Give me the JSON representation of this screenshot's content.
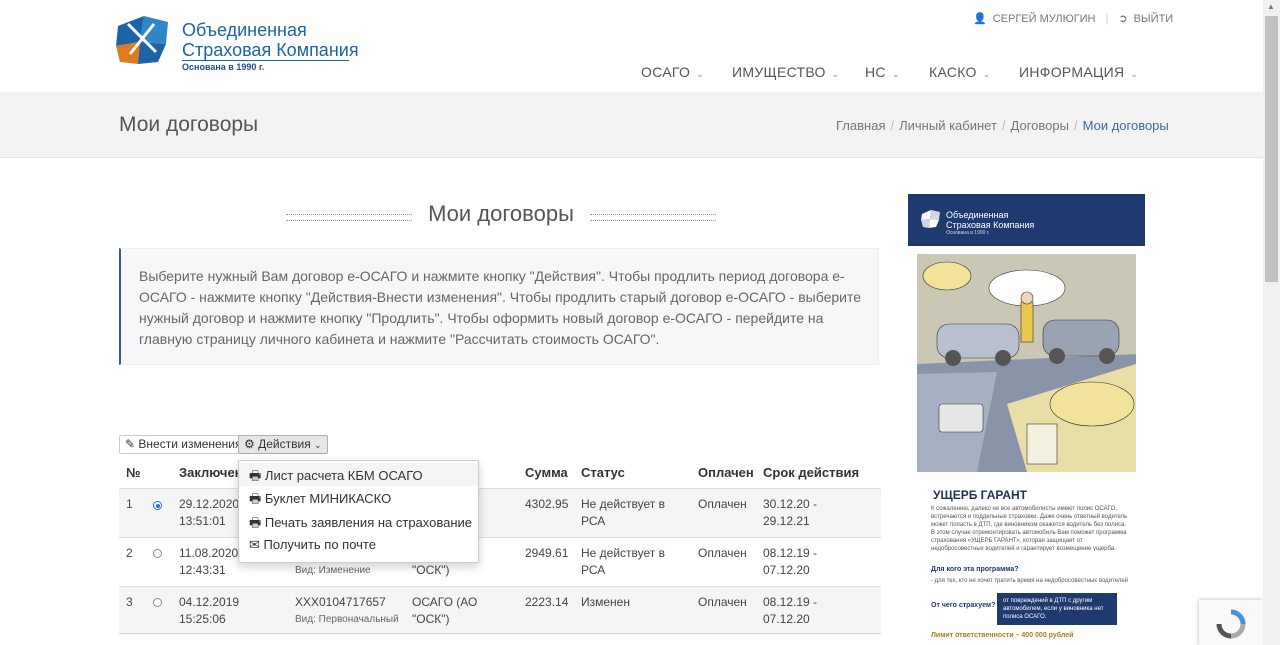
{
  "logo": {
    "line1": "Объединенная",
    "line2": "Страховая Компания",
    "founded": "Основана в 1990 г."
  },
  "topbar": {
    "user": "СЕРГЕЙ МУЛЮГИН",
    "logout": "ВЫЙТИ"
  },
  "nav": {
    "items": [
      {
        "label": "ОСАГО"
      },
      {
        "label": "ИМУЩЕСТВО"
      },
      {
        "label": "НС"
      },
      {
        "label": "КАСКО"
      },
      {
        "label": "ИНФОРМАЦИЯ"
      }
    ]
  },
  "page": {
    "title": "Мои договоры",
    "section_title": "Мои договоры"
  },
  "breadcrumb": [
    "Главная",
    "Личный кабинет",
    "Договоры",
    "Мои договоры"
  ],
  "info_text": "Выберите нужный Вам договор е-ОСАГО и нажмите кнопку \"Действия\". Чтобы продлить период договора е-ОСАГО - нажмите кнопку \"Действия-Внести изменения\". Чтобы продлить старый договор е-ОСАГО - выберите нужный договор и нажмите кнопку \"Продлить\". Чтобы оформить новый договор е-ОСАГО - перейдите на главную страницу личного кабинета и нажмите \"Рассчитать стоимость ОСАГО\".",
  "buttons": {
    "edit": "Внести изменения",
    "actions": "Действия"
  },
  "dropdown": [
    "Лист расчета КБМ ОСАГО",
    "Буклет МИНИКАСКО",
    "Печать заявления на страхование",
    "Получить по почте"
  ],
  "table": {
    "headers": {
      "num": "№",
      "date": "Заключен",
      "sum": "Сумма",
      "status": "Статус",
      "paid": "Оплачен",
      "term": "Срок действия"
    },
    "rows": [
      {
        "num": "1",
        "date": "29.12.2020",
        "time": "13:51:01",
        "policy": "",
        "kind": "",
        "product1": "",
        "product2": "",
        "sum": "4302.95",
        "status1": "Не действует в",
        "status2": "РСА",
        "paid": "Оплачен",
        "term1": "30.12.20 -",
        "term2": "29.12.21"
      },
      {
        "num": "2",
        "date": "11.08.2020",
        "time": "12:43:31",
        "policy": "",
        "kind": "Вид: Изменение",
        "product1": "",
        "product2": "\"ОСК\")",
        "sum": "2949.61",
        "status1": "Не действует в",
        "status2": "РСА",
        "paid": "Оплачен",
        "term1": "08.12.19 -",
        "term2": "07.12.20"
      },
      {
        "num": "3",
        "date": "04.12.2019",
        "time": "15:25:06",
        "policy": "XXX0104717657",
        "kind": "Вид: Первоначальный",
        "product1": "ОСАГО (АО",
        "product2": "\"ОСК\")",
        "sum": "2223.14",
        "status1": "Изменен",
        "status2": "",
        "paid": "Оплачен",
        "term1": "08.12.19 -",
        "term2": "07.12.20"
      }
    ]
  },
  "ad": {
    "brand1": "Объединенная",
    "brand2": "Страховая Компания",
    "brand3": "Основана в 1990 г.",
    "title": "УЩЕРБ ГАРАНТ",
    "body": "К сожалению, далеко не все автомобилисты имеют полис ОСАГО, встречаются и поддельные страховки. Даже очень ответный водитель может попасть в ДТП, где виновником окажется водитель без полиса. В этом случае отремонтировать автомобиль Вам поможет программа страхования «УЩЕРБ ГАРАНТ», которая защищает от недобросовестных водителей и гарантирует возмещение ущерба.",
    "q1": "Для кого эта программа?",
    "a1": "- для тех, кто не хочет тратить время на недобросовестных водителей",
    "q2": "От чего страхуем?",
    "a2": "от повреждений в ДТП с другим автомобилем, если у виновника нет полиса ОСАГО.",
    "limit": "Лимит ответственности – 400 000 рублей"
  },
  "colors": {
    "brand": "#1d63a8",
    "navy": "#1f3a6e",
    "accent": "#3a5a8c"
  }
}
